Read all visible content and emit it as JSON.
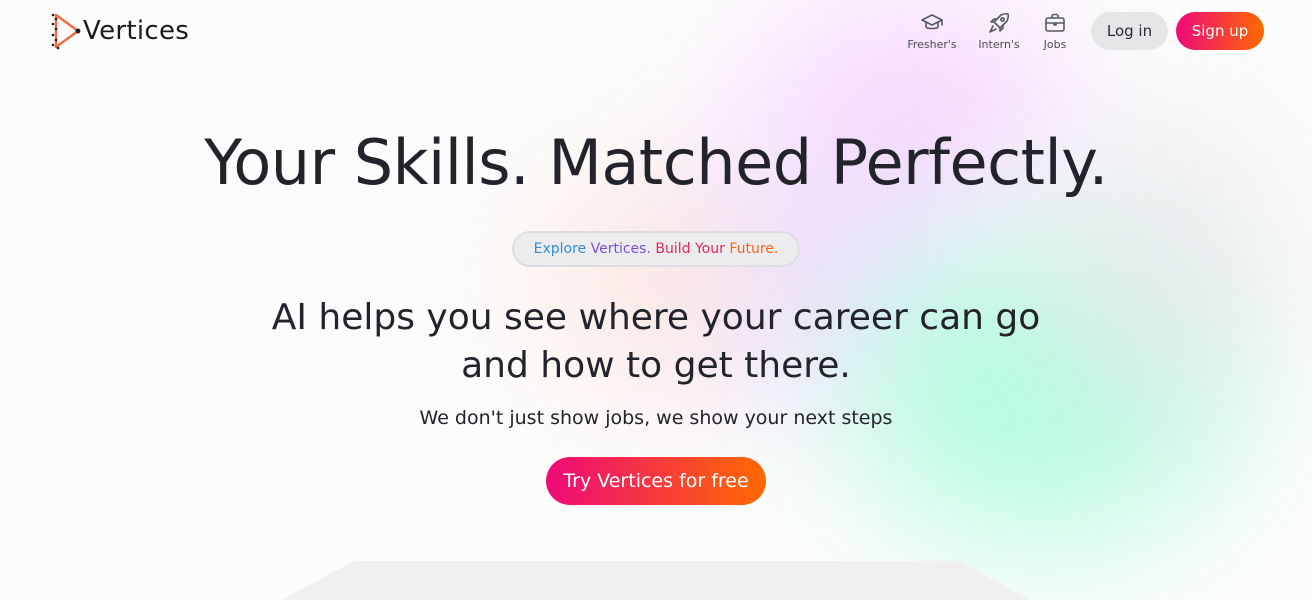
{
  "brand": {
    "name": "Vertices",
    "accent_start": "#ee0979",
    "accent_end": "#ff6a00"
  },
  "nav": {
    "items": [
      {
        "label": "Fresher's",
        "icon": "graduation-cap-icon"
      },
      {
        "label": "Intern's",
        "icon": "rocket-icon"
      },
      {
        "label": "Jobs",
        "icon": "briefcase-icon"
      }
    ],
    "login_label": "Log in",
    "signup_label": "Sign up"
  },
  "hero": {
    "title": "Your Skills. Matched Perfectly.",
    "pill": {
      "part1": "Explore",
      "part2": "Vertices.",
      "part3": "Build Your",
      "part4": "Future."
    },
    "subtitle_line1": "AI helps you see where your career can go",
    "subtitle_line2": "and how to get there.",
    "tagline": "We don't just show jobs, we show your next steps",
    "cta_label": "Try Vertices for free"
  }
}
